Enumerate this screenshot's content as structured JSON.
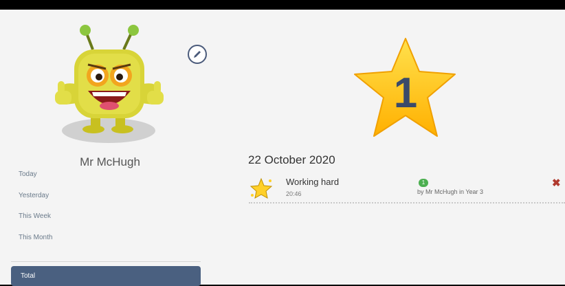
{
  "profile": {
    "name": "Mr McHugh",
    "edit_icon": "pencil-icon"
  },
  "sidebar": {
    "items": [
      {
        "label": "Today"
      },
      {
        "label": "Yesterday"
      },
      {
        "label": "This Week"
      },
      {
        "label": "This Month"
      }
    ],
    "total_label": "Total"
  },
  "summary": {
    "star_count": "1",
    "star_color": "#ffb300"
  },
  "feed": {
    "date": "22 October 2020",
    "entries": [
      {
        "title": "Working hard",
        "time": "20:46",
        "points": "1",
        "by": "by Mr McHugh in Year 3",
        "delete_icon": "close-icon"
      }
    ]
  },
  "colors": {
    "accent": "#4a6080",
    "points_badge": "#4caf50",
    "delete": "#b03a2e"
  }
}
